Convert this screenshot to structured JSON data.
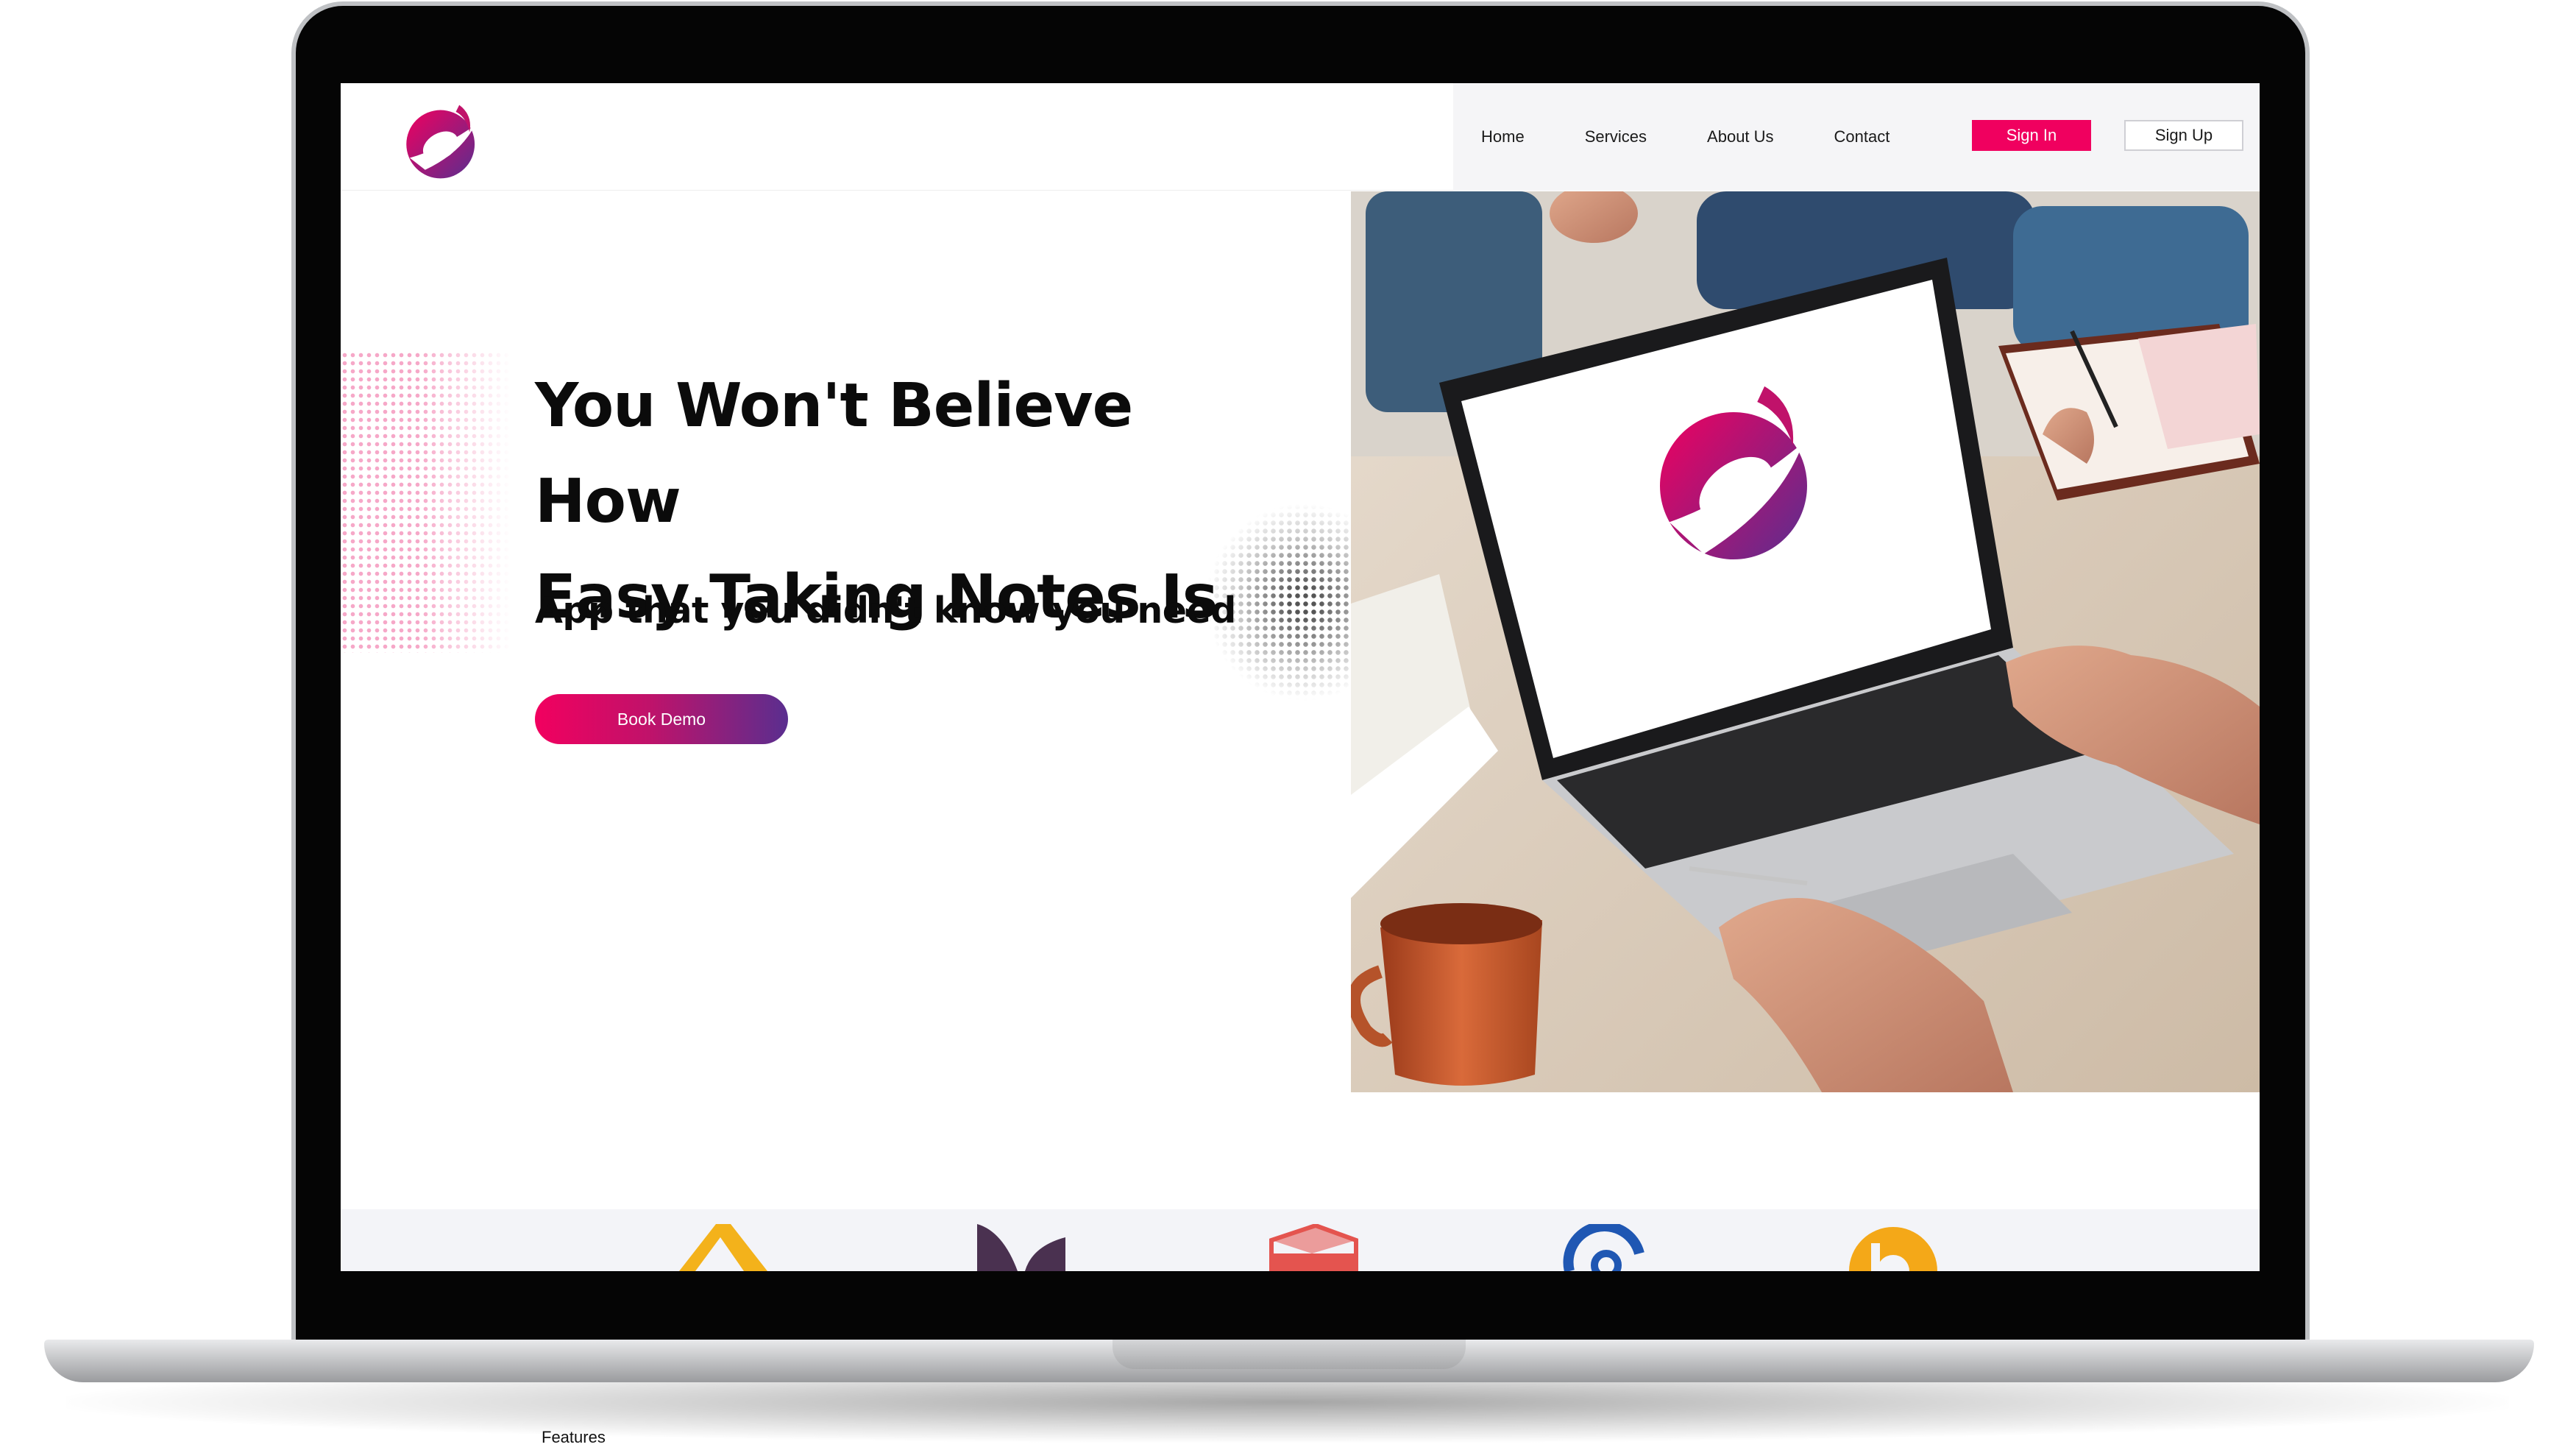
{
  "nav": {
    "links": [
      "Home",
      "Services",
      "About Us",
      "Contact"
    ],
    "sign_in": "Sign In",
    "sign_up": "Sign Up"
  },
  "hero": {
    "title_line1": "You Won't Believe How",
    "title_line2": "Easy Taking Notes Is",
    "subtitle": "App that you didn't know you need",
    "cta": "Book Demo"
  },
  "caption": "Features",
  "colors": {
    "accent": "#f0005f",
    "brand_purple": "#5a2e8f",
    "nav_bg": "#f5f5f7",
    "laptop_bezel": "#050505"
  },
  "icons": {
    "brand": "swoosh-circle-logo",
    "partners": [
      "yellow-triangle-logo",
      "purple-leaf-logo",
      "red-box-logo",
      "blue-ring-logo",
      "orange-d-logo"
    ]
  }
}
